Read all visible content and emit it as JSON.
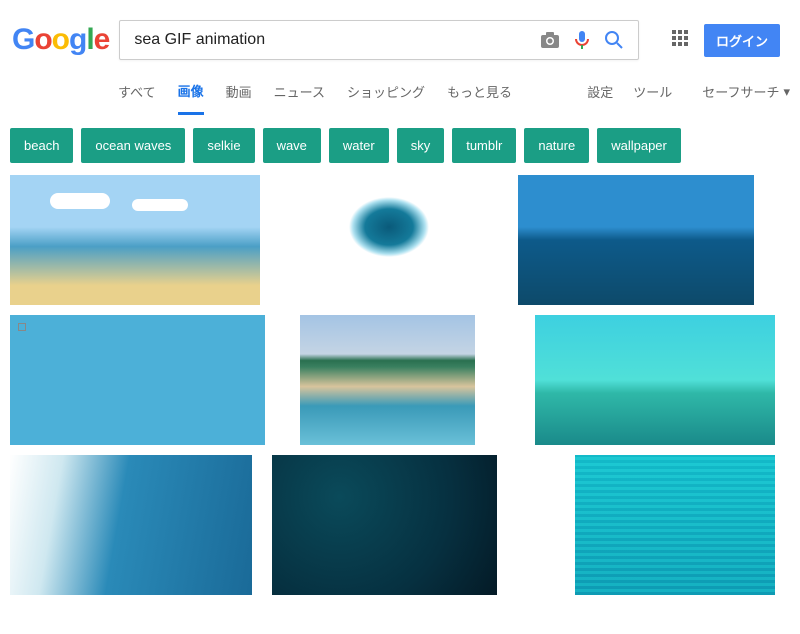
{
  "logo_letters": [
    "G",
    "o",
    "o",
    "g",
    "l",
    "e"
  ],
  "search": {
    "value": "sea GIF animation"
  },
  "login_label": "ログイン",
  "nav": {
    "tabs": [
      {
        "label": "すべて"
      },
      {
        "label": "画像",
        "active": true
      },
      {
        "label": "動画"
      },
      {
        "label": "ニュース"
      },
      {
        "label": "ショッピング"
      },
      {
        "label": "もっと見る"
      }
    ],
    "settings": "設定",
    "tools": "ツール",
    "safesearch": "セーフサーチ"
  },
  "chips": [
    "beach",
    "ocean waves",
    "selkie",
    "wave",
    "water",
    "sky",
    "tumblr",
    "nature",
    "wallpaper"
  ]
}
